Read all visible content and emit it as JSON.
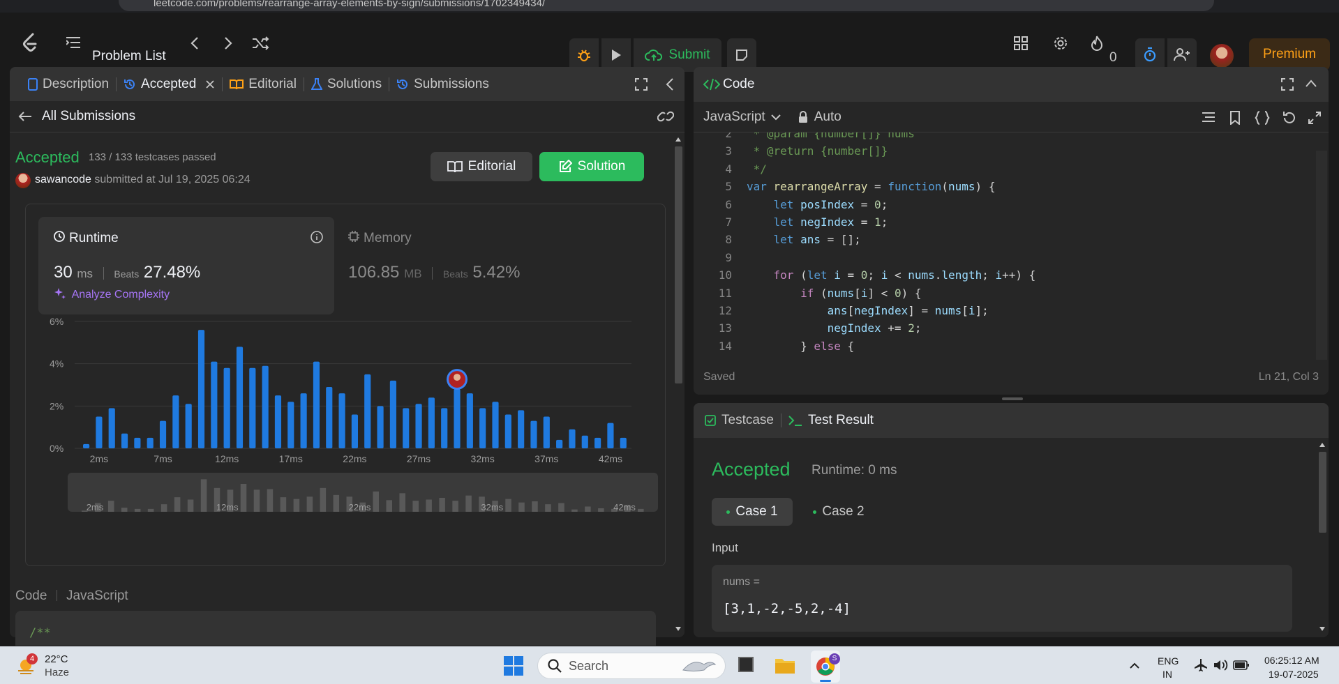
{
  "browser": {
    "url": "leetcode.com/problems/rearrange-array-elements-by-sign/submissions/1702349434/"
  },
  "nav": {
    "problem_list": "Problem List",
    "submit": "Submit",
    "streak": "0",
    "premium": "Premium"
  },
  "left": {
    "tabs": [
      "Description",
      "Accepted",
      "Editorial",
      "Solutions",
      "Submissions"
    ],
    "back_label": "All Submissions",
    "status": "Accepted",
    "testcases": "133 / 133 testcases passed",
    "user": "sawancode",
    "submitted_at": "submitted at Jul 19, 2025 06:24",
    "editorial_btn": "Editorial",
    "solution_btn": "Solution",
    "runtime": {
      "label": "Runtime",
      "value": "30",
      "unit": "ms",
      "beats_label": "Beats",
      "beats": "27.48%"
    },
    "memory": {
      "label": "Memory",
      "value": "106.85",
      "unit": "MB",
      "beats_label": "Beats",
      "beats": "5.42%"
    },
    "analyze": "Analyze Complexity",
    "code_label": "Code",
    "code_lang": "JavaScript",
    "code_preview": "/**"
  },
  "chart_data": {
    "type": "bar",
    "ylabel": "",
    "xlabel": "",
    "ylim": [
      0,
      6
    ],
    "ytick_labels": [
      "0%",
      "2%",
      "4%",
      "6%"
    ],
    "xtick_labels": [
      "2ms",
      "7ms",
      "12ms",
      "17ms",
      "22ms",
      "27ms",
      "32ms",
      "37ms",
      "42ms"
    ],
    "x_start_ms": 1,
    "x_step_ms": 1,
    "highlight_ms": 30,
    "values": [
      0.2,
      1.5,
      1.9,
      0.7,
      0.5,
      0.5,
      1.3,
      2.5,
      2.1,
      5.6,
      4.1,
      3.8,
      4.8,
      3.8,
      3.9,
      2.5,
      2.2,
      2.6,
      4.1,
      2.9,
      2.6,
      1.6,
      3.5,
      2.0,
      3.2,
      1.9,
      2.1,
      2.4,
      1.9,
      2.8,
      2.6,
      1.9,
      2.2,
      1.6,
      1.8,
      1.3,
      1.5,
      0.4,
      0.9,
      0.6,
      0.5,
      1.2,
      0.5
    ],
    "minimap_labels": [
      "2ms",
      "12ms",
      "22ms",
      "32ms",
      "42ms"
    ]
  },
  "right": {
    "code_title": "Code",
    "language": "JavaScript",
    "mode": "Auto",
    "code_lines": [
      {
        "n": "2",
        "t": " * @param {number[]} nums"
      },
      {
        "n": "3",
        "t": " * @return {number[]}"
      },
      {
        "n": "4",
        "t": " */"
      },
      {
        "n": "5",
        "t": "var rearrangeArray = function(nums) {"
      },
      {
        "n": "6",
        "t": "    let posIndex = 0;"
      },
      {
        "n": "7",
        "t": "    let negIndex = 1;"
      },
      {
        "n": "8",
        "t": "    let ans = [];"
      },
      {
        "n": "9",
        "t": ""
      },
      {
        "n": "10",
        "t": "    for (let i = 0; i < nums.length; i++) {"
      },
      {
        "n": "11",
        "t": "        if (nums[i] < 0) {"
      },
      {
        "n": "12",
        "t": "            ans[negIndex] = nums[i];"
      },
      {
        "n": "13",
        "t": "            negIndex += 2;"
      },
      {
        "n": "14",
        "t": "        } else {"
      }
    ],
    "saved": "Saved",
    "cursor": "Ln 21, Col 3",
    "tabs": [
      "Testcase",
      "Test Result"
    ],
    "result_status": "Accepted",
    "result_runtime": "Runtime: 0 ms",
    "cases": [
      "Case 1",
      "Case 2"
    ],
    "input_label": "Input",
    "var_name": "nums =",
    "var_value": "[3,1,-2,-5,2,-4]"
  },
  "taskbar": {
    "weather_badge": "4",
    "temp": "22°C",
    "condition": "Haze",
    "search": "Search",
    "lang1": "ENG",
    "lang2": "IN",
    "time": "06:25:12 AM",
    "date": "19-07-2025",
    "chrome_badge": "S"
  }
}
